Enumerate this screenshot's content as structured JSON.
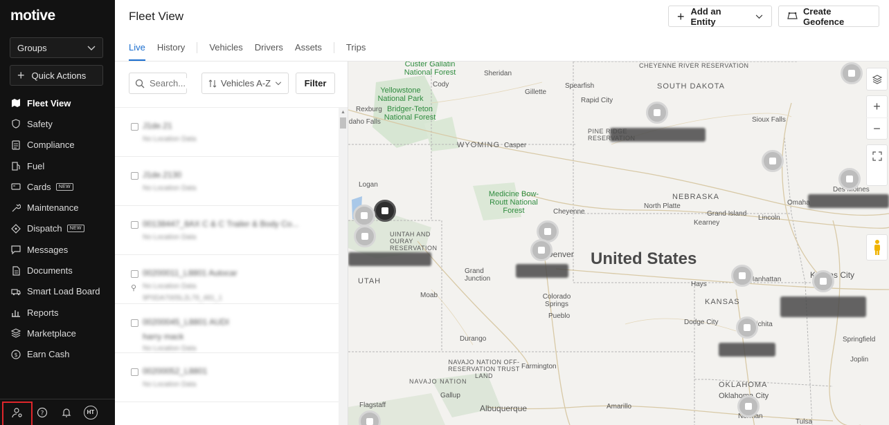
{
  "app": {
    "logo": "motive"
  },
  "sidebar": {
    "groups_label": "Groups",
    "quick_actions_label": "Quick Actions",
    "items": [
      {
        "label": "Fleet View",
        "icon": "map-icon",
        "active": true
      },
      {
        "label": "Safety",
        "icon": "shield-icon"
      },
      {
        "label": "Compliance",
        "icon": "document-icon"
      },
      {
        "label": "Fuel",
        "icon": "fuel-icon"
      },
      {
        "label": "Cards",
        "icon": "card-icon",
        "badge": "NEW"
      },
      {
        "label": "Maintenance",
        "icon": "wrench-icon"
      },
      {
        "label": "Dispatch",
        "icon": "dispatch-icon",
        "badge": "NEW"
      },
      {
        "label": "Messages",
        "icon": "chat-icon"
      },
      {
        "label": "Documents",
        "icon": "file-icon"
      },
      {
        "label": "Smart Load Board",
        "icon": "truck-icon"
      },
      {
        "label": "Reports",
        "icon": "chart-icon"
      },
      {
        "label": "Marketplace",
        "icon": "layers-icon"
      },
      {
        "label": "Earn Cash",
        "icon": "dollar-icon"
      }
    ],
    "footer": {
      "avatar_initials": "HT"
    }
  },
  "header": {
    "title": "Fleet View",
    "add_entity_label": "Add an Entity",
    "create_geofence_label": "Create Geofence",
    "tabs": [
      "Live",
      "History",
      "Vehicles",
      "Drivers",
      "Assets",
      "Trips"
    ]
  },
  "list": {
    "search_placeholder": "Search...",
    "sort_label": "Vehicles A-Z",
    "filter_label": "Filter",
    "rows": [
      {
        "l1": "J1de.21",
        "l2": "No Location Data"
      },
      {
        "l1": "J1de.2130",
        "l2": "No Location Data"
      },
      {
        "l1": "00138447_8AX   C & C Trailer & Body Co...",
        "l2": "No Location Data"
      },
      {
        "l1": "00200011_L8801   Autocar",
        "l2": "No Location Data",
        "l3": "9P0DA7005L2L79_481_1"
      },
      {
        "l1": "00200045_L8801   AUDI",
        "l2": "harry mack",
        "l3": "No Location Data"
      },
      {
        "l1": "00200052_L8801",
        "l2": "No Location Data"
      }
    ]
  },
  "map": {
    "country_label": "United States",
    "states": [
      "WYOMING",
      "SOUTH DAKOTA",
      "NEBRASKA",
      "KANSAS",
      "UTAH",
      "OKLAHOMA",
      "NAVAJO NATION",
      "UINTAH AND OURAY RESERVATION",
      "PINE RIDGE RESERVATION",
      "CHEYENNE RIVER RESERVATION",
      "NAVAJO NATION OFF-RESERVATION TRUST LAND"
    ],
    "parks": [
      "Custer Gallatin National Forest",
      "Yellowstone National Park",
      "Bridger-Teton National Forest",
      "Medicine Bow-Routt National Forest"
    ],
    "cities": [
      "Sheridan",
      "Cody",
      "Gillette",
      "Spearfish",
      "Rapid City",
      "Sioux Falls",
      "Rexburg",
      "Idaho Falls",
      "Casper",
      "Logan",
      "North Platte",
      "Grand Island",
      "Kearney",
      "Lincoln",
      "Omaha",
      "Des Moines",
      "Cheyenne",
      "Denver",
      "Grand Junction",
      "Moab",
      "Colorado Springs",
      "Pueblo",
      "Hays",
      "Manhattan",
      "Kansas City",
      "Dodge City",
      "Wichita",
      "Springfield",
      "Joplin",
      "Durango",
      "Farmington",
      "Gallup",
      "Flagstaff",
      "Albuquerque",
      "Amarillo",
      "Oklahoma City",
      "Norman",
      "Tulsa"
    ]
  },
  "colors": {
    "accent": "#1b6ecf",
    "sidebar_bg": "#121212",
    "highlight": "#e0262b",
    "park_text": "#2e8b3e"
  }
}
